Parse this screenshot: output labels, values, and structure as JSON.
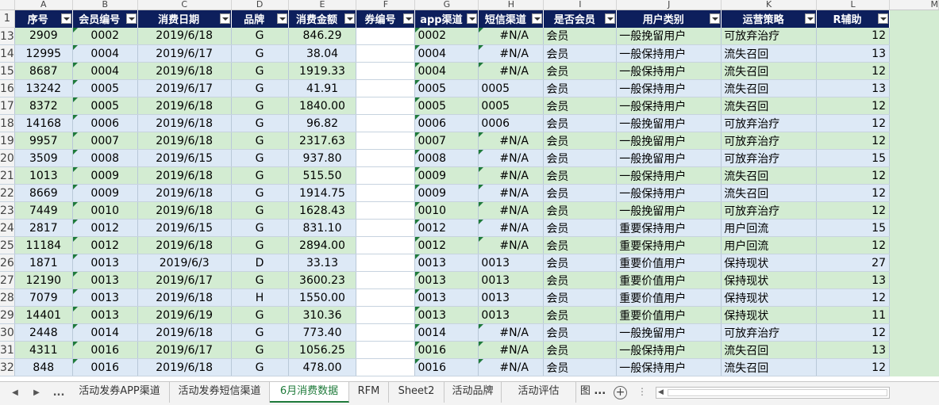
{
  "columns": [
    "A",
    "B",
    "C",
    "D",
    "E",
    "F",
    "G",
    "H",
    "I",
    "J",
    "K",
    "L",
    "M"
  ],
  "header_row_number": "1",
  "headers": [
    "序号",
    "会员编号",
    "消费日期",
    "品牌",
    "消费金额",
    "券编号",
    "app渠道",
    "短信渠道",
    "是否会员",
    "用户类别",
    "运营策略",
    "R辅助"
  ],
  "rows": [
    {
      "n": "13",
      "c": [
        "2909",
        "0002",
        "2019/6/18",
        "G",
        "846.29",
        "",
        "0002",
        "#N/A",
        "会员",
        "一般挽留用户",
        "可放弃治疗",
        "12"
      ]
    },
    {
      "n": "14",
      "c": [
        "12995",
        "0004",
        "2019/6/17",
        "G",
        "38.04",
        "",
        "0004",
        "#N/A",
        "会员",
        "一般保持用户",
        "流失召回",
        "13"
      ]
    },
    {
      "n": "15",
      "c": [
        "8687",
        "0004",
        "2019/6/18",
        "G",
        "1919.33",
        "",
        "0004",
        "#N/A",
        "会员",
        "一般保持用户",
        "流失召回",
        "12"
      ]
    },
    {
      "n": "16",
      "c": [
        "13242",
        "0005",
        "2019/6/17",
        "G",
        "41.91",
        "",
        "0005",
        "0005",
        "会员",
        "一般保持用户",
        "流失召回",
        "13"
      ]
    },
    {
      "n": "17",
      "c": [
        "8372",
        "0005",
        "2019/6/18",
        "G",
        "1840.00",
        "",
        "0005",
        "0005",
        "会员",
        "一般保持用户",
        "流失召回",
        "12"
      ]
    },
    {
      "n": "18",
      "c": [
        "14168",
        "0006",
        "2019/6/18",
        "G",
        "96.82",
        "",
        "0006",
        "0006",
        "会员",
        "一般挽留用户",
        "可放弃治疗",
        "12"
      ]
    },
    {
      "n": "19",
      "c": [
        "9957",
        "0007",
        "2019/6/18",
        "G",
        "2317.63",
        "",
        "0007",
        "#N/A",
        "会员",
        "一般挽留用户",
        "可放弃治疗",
        "12"
      ]
    },
    {
      "n": "20",
      "c": [
        "3509",
        "0008",
        "2019/6/15",
        "G",
        "937.80",
        "",
        "0008",
        "#N/A",
        "会员",
        "一般挽留用户",
        "可放弃治疗",
        "15"
      ]
    },
    {
      "n": "21",
      "c": [
        "1013",
        "0009",
        "2019/6/18",
        "G",
        "515.50",
        "",
        "0009",
        "#N/A",
        "会员",
        "一般保持用户",
        "流失召回",
        "12"
      ]
    },
    {
      "n": "22",
      "c": [
        "8669",
        "0009",
        "2019/6/18",
        "G",
        "1914.75",
        "",
        "0009",
        "#N/A",
        "会员",
        "一般保持用户",
        "流失召回",
        "12"
      ]
    },
    {
      "n": "23",
      "c": [
        "7449",
        "0010",
        "2019/6/18",
        "G",
        "1628.43",
        "",
        "0010",
        "#N/A",
        "会员",
        "一般挽留用户",
        "可放弃治疗",
        "12"
      ]
    },
    {
      "n": "24",
      "c": [
        "2817",
        "0012",
        "2019/6/15",
        "G",
        "831.10",
        "",
        "0012",
        "#N/A",
        "会员",
        "重要保持用户",
        "用户回流",
        "15"
      ]
    },
    {
      "n": "25",
      "c": [
        "11184",
        "0012",
        "2019/6/18",
        "G",
        "2894.00",
        "",
        "0012",
        "#N/A",
        "会员",
        "重要保持用户",
        "用户回流",
        "12"
      ]
    },
    {
      "n": "26",
      "c": [
        "1871",
        "0013",
        "2019/6/3",
        "D",
        "33.13",
        "",
        "0013",
        "0013",
        "会员",
        "重要价值用户",
        "保持现状",
        "27"
      ]
    },
    {
      "n": "27",
      "c": [
        "12190",
        "0013",
        "2019/6/17",
        "G",
        "3600.23",
        "",
        "0013",
        "0013",
        "会员",
        "重要价值用户",
        "保持现状",
        "13"
      ]
    },
    {
      "n": "28",
      "c": [
        "7079",
        "0013",
        "2019/6/18",
        "H",
        "1550.00",
        "",
        "0013",
        "0013",
        "会员",
        "重要价值用户",
        "保持现状",
        "12"
      ]
    },
    {
      "n": "29",
      "c": [
        "14401",
        "0013",
        "2019/6/19",
        "G",
        "310.36",
        "",
        "0013",
        "0013",
        "会员",
        "重要价值用户",
        "保持现状",
        "11"
      ]
    },
    {
      "n": "30",
      "c": [
        "2448",
        "0014",
        "2019/6/18",
        "G",
        "773.40",
        "",
        "0014",
        "#N/A",
        "会员",
        "一般挽留用户",
        "可放弃治疗",
        "12"
      ]
    },
    {
      "n": "31",
      "c": [
        "4311",
        "0016",
        "2019/6/17",
        "G",
        "1056.25",
        "",
        "0016",
        "#N/A",
        "会员",
        "一般保持用户",
        "流失召回",
        "13"
      ]
    },
    {
      "n": "32",
      "c": [
        "848",
        "0016",
        "2019/6/18",
        "G",
        "478.00",
        "",
        "0016",
        "#N/A",
        "会员",
        "一般保持用户",
        "流失召回",
        "12"
      ]
    }
  ],
  "sheet_tabs": [
    "活动发券APP渠道",
    "活动发券短信渠道",
    "6月消费数据",
    "RFM",
    "Sheet2",
    "活动品牌",
    "活动评估",
    "图"
  ],
  "active_tab": "6月消费数据",
  "overflow_label": "...",
  "more_tabs_label": "...",
  "colors": {
    "header_bg": "#0d1f5c",
    "row_green": "#d3ecd2",
    "row_blue": "#dde9f6",
    "active_tab": "#1e7a3a"
  }
}
